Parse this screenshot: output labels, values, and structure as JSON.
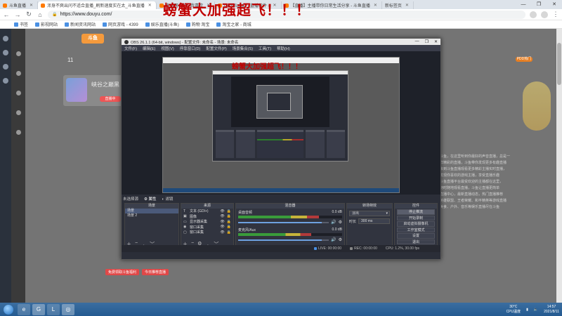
{
  "browser": {
    "tabs": [
      {
        "label": "斗鱼直播",
        "active": false
      },
      {
        "label": "浑身不爽出问不适合直播_刷新速度实在太_斗鱼直播",
        "active": true
      },
      {
        "label": "淘宝网 - 淘！我喜欢",
        "active": false
      },
      {
        "label": "OBS Studio - 直播软件 -",
        "active": false
      },
      {
        "label": "【直播】主播带你日常生活分享 - 斗鱼直播",
        "active": false
      },
      {
        "label": "新标签页",
        "active": false
      }
    ],
    "address": "douyu.com/...",
    "address_full": "https://www.douyu.com/",
    "bookmarks": [
      "书签",
      "影视网站",
      "新闻资讯网站",
      "网页游戏 - 4399",
      "娱乐直播(斗鱼)",
      "购物 淘宝",
      "淘宝之家 - 商城"
    ],
    "caption": "螃蟹大加强超飞！！！",
    "window_controls": [
      "—",
      "❐",
      "✕"
    ]
  },
  "page": {
    "logo": "斗鱼",
    "stream_title": "峡谷之巅黑",
    "live_badge": "直播中",
    "sub_count": "11",
    "fg_badge": "PDD热门",
    "article_lines": [
      "斗鱼，在这里听到你最好的声音直播，总是一",
      "样精彩的直播，斗鱼带你发现更多有趣直播",
      "来到斗鱼直播观看更多精彩主播实时直播，",
      "发现你喜欢的游戏主播，享受直播乐趣",
      "斗鱼直播平台最受欢迎的主播都在这里，",
      "随时随地观看直播，斗鱼让直播更简单",
      "直播中心，最新直播动态，热门直播推荐",
      "英雄联盟、王者荣耀、和平精英等游戏直播",
      "美食、户外、音乐等娱乐直播尽在斗鱼"
    ],
    "bottom_chips": [
      "免费领取斗鱼福利",
      "今日推荐直播"
    ]
  },
  "obs": {
    "title": "OBS 26.1.1 (64-bit, windows) - 配置文件: 未命名 - 场景: 未命名",
    "menu": [
      "文件(F)",
      "编辑(E)",
      "视图(V)",
      "停靠窗口(D)",
      "配置文件(P)",
      "场景集合(S)",
      "工具(T)",
      "帮助(H)"
    ],
    "nested_caption": "螃蟹大加强超飞！！！",
    "scene_bar": [
      "未选择源",
      "属性",
      "滤镜"
    ],
    "docks": {
      "scenes": {
        "title": "场景",
        "items": [
          "场景",
          "场景 2"
        ],
        "selected": 0
      },
      "sources": {
        "title": "来源",
        "items": [
          {
            "glyph": "T",
            "name": "文本 (GDI+)"
          },
          {
            "glyph": "▣",
            "name": "图像"
          },
          {
            "glyph": "▭",
            "name": "显示器采集"
          },
          {
            "glyph": "◉",
            "name": "窗口采集"
          },
          {
            "glyph": "▢",
            "name": "窗口采集"
          }
        ]
      },
      "mixer": {
        "title": "混音器",
        "channels": [
          {
            "name": "桌面音频",
            "level": "0.0 dB",
            "meter": 0.78,
            "volume": 0.92
          },
          {
            "name": "麦克风/Aux",
            "level": "0.0 dB",
            "meter": 0.7,
            "volume": 0.92
          }
        ]
      },
      "transitions": {
        "title": "转场特效",
        "selected": "淡出",
        "duration_label": "时长",
        "duration": "300 ms"
      },
      "controls": {
        "title": "控件",
        "buttons": [
          "停止推流",
          "开始录制",
          "启动虚拟摄像机",
          "工作室模式",
          "设置",
          "退出"
        ]
      }
    },
    "status": {
      "live": "LIVE: 00:00:00",
      "rec": "REC: 00:00:00",
      "cpu": "CPU: 1.2%, 30.00 fps"
    }
  },
  "taskbar": {
    "apps": [
      "e",
      "G",
      "L",
      "◎"
    ],
    "weather": "30°C",
    "weather_sub": "CPU温度",
    "time": "14:57",
    "date": "2021/8/11"
  }
}
